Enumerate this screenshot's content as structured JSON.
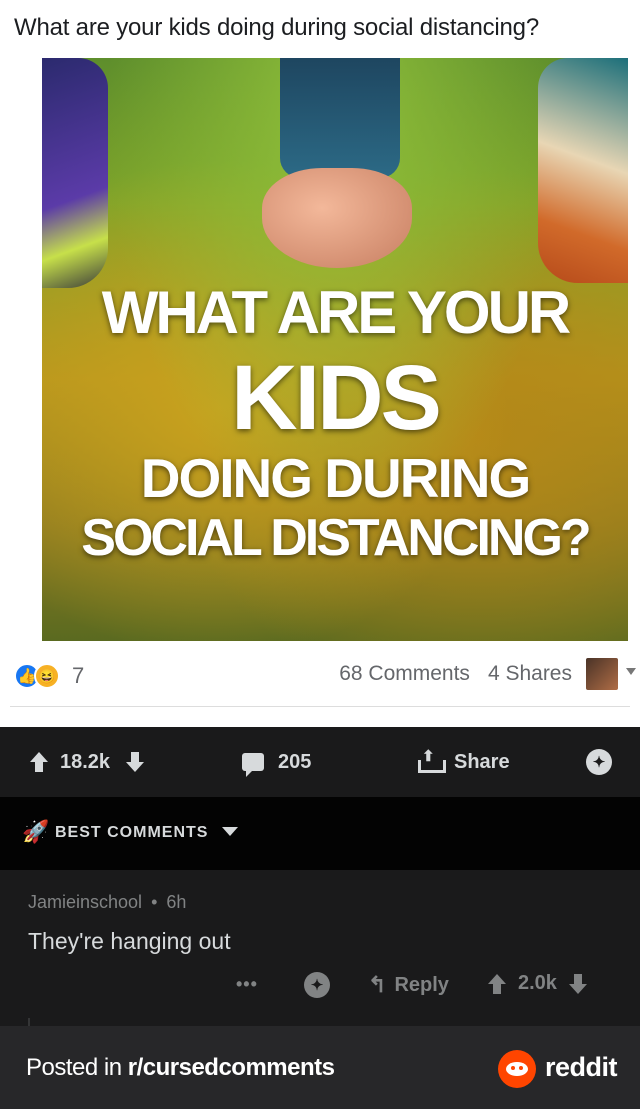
{
  "facebook_post": {
    "question": "What are your kids doing during social distancing?",
    "image_headline": {
      "line1": "WHAT ARE YOUR",
      "line2": "KIDS",
      "line3": "DOING DURING",
      "line4": "SOCIAL DISTANCING?"
    },
    "reaction_icons": [
      "like-icon",
      "haha-icon"
    ],
    "reaction_count": "7",
    "comments_text": "68 Comments",
    "shares_text": "4 Shares"
  },
  "reddit_post_bar": {
    "upvotes": "18.2k",
    "comments": "205",
    "share_label": "Share"
  },
  "best_comments": {
    "label": "BEST COMMENTS"
  },
  "comment": {
    "author": "Jamieinschool",
    "separator": "•",
    "age": "6h",
    "body": "They're hanging out",
    "more": "•••",
    "reply_label": "Reply",
    "score": "2.0k"
  },
  "footer": {
    "posted_prefix": "Posted in ",
    "subreddit": "r/cursedcomments",
    "brand": "reddit"
  },
  "colors": {
    "reddit_bg": "#1a1a1b",
    "footer_bg": "#272729",
    "reddit_orange": "#ff4500",
    "facebook_blue": "#1877f2",
    "text_light": "#d7dadc",
    "text_muted": "#818384"
  }
}
